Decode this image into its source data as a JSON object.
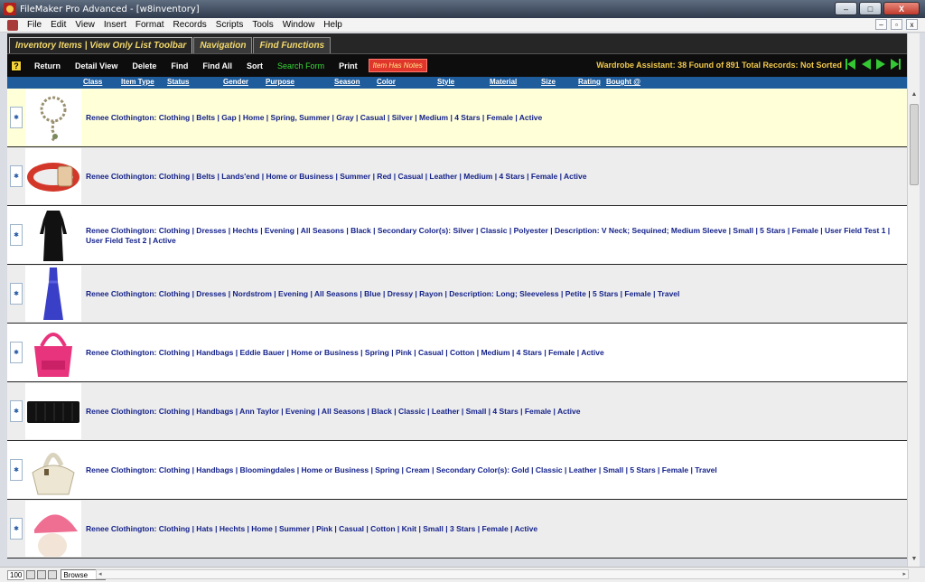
{
  "window": {
    "title": "FileMaker Pro Advanced - [w8inventory]",
    "controls": {
      "minimize": "–",
      "maximize": "□",
      "close": "X"
    }
  },
  "menu": {
    "items": [
      "File",
      "Edit",
      "View",
      "Insert",
      "Format",
      "Records",
      "Scripts",
      "Tools",
      "Window",
      "Help"
    ],
    "doc_controls": {
      "minimize": "–",
      "restore": "▫",
      "close": "x"
    }
  },
  "tabs": [
    {
      "label": "Inventory Items | View Only List Toolbar"
    },
    {
      "label": "Navigation"
    },
    {
      "label": "Find Functions"
    }
  ],
  "toolbar": {
    "help": "?",
    "return": "Return",
    "detail_view": "Detail View",
    "delete": "Delete",
    "find": "Find",
    "find_all": "Find All",
    "sort": "Sort",
    "search_form": "Search Form",
    "print": "Print",
    "item_has_notes": "Item Has Notes",
    "status": "Wardrobe Assistant:  38 Found of 891 Total Records: Not Sorted"
  },
  "columns": [
    "Class",
    "Item Type",
    "Status",
    "Gender",
    "Purpose",
    "Season",
    "Color",
    "Style",
    "Material",
    "Size",
    "Rating",
    "Bought @"
  ],
  "rows": [
    {
      "text": "Renee Clothington: Clothing | Belts | Gap | Home | Spring, Summer | Gray | Casual | Silver | Medium | 4 Stars | Female | Active",
      "thumb": "chain-belt"
    },
    {
      "text": "Renee Clothington: Clothing | Belts | Lands'end | Home or Business | Summer | Red | Casual | Leather | Medium | 4 Stars | Female | Active",
      "thumb": "red-belt"
    },
    {
      "text": "Renee Clothington: Clothing | Dresses | Hechts | Evening | All Seasons | Black | Secondary Color(s): Silver | Classic | Polyester | Description: V Neck; Sequined; Medium Sleeve | Small | 5 Stars | Female | User Field Test 1  | User Field Test 2  | Active",
      "thumb": "black-dress"
    },
    {
      "text": "Renee Clothington: Clothing | Dresses | Nordstrom | Evening | All Seasons | Blue | Dressy | Rayon | Description: Long; Sleeveless | Petite | 5 Stars | Female | Travel",
      "thumb": "blue-gown"
    },
    {
      "text": "Renee Clothington: Clothing | Handbags | Eddie Bauer | Home or Business | Spring | Pink | Casual | Cotton | Medium | 4 Stars | Female | Active",
      "thumb": "pink-handbag"
    },
    {
      "text": "Renee Clothington: Clothing | Handbags | Ann Taylor | Evening | All Seasons | Black | Classic | Leather | Small | 4 Stars | Female | Active",
      "thumb": "black-clutch"
    },
    {
      "text": "Renee Clothington: Clothing | Handbags | Bloomingdales | Home or Business | Spring | Cream | Secondary Color(s): Gold | Classic | Leather | Small | 5 Stars | Female | Travel",
      "thumb": "cream-hobo-bag"
    },
    {
      "text": "Renee Clothington: Clothing | Hats | Hechts | Home | Summer | Pink | Casual | Cotton | Knit | Small | 3 Stars | Female | Active",
      "thumb": "pink-cap"
    }
  ],
  "statusbar": {
    "zoom": "100",
    "mode": "Browse"
  },
  "colors": {
    "toolbar_bg": "#262626",
    "tab_text": "#f2d86b",
    "header_blue": "#1f5c9c",
    "row_text": "#14228a",
    "selected_row": "#ffffd8",
    "notes_red": "#e0352b",
    "nav_green": "#34c834"
  }
}
